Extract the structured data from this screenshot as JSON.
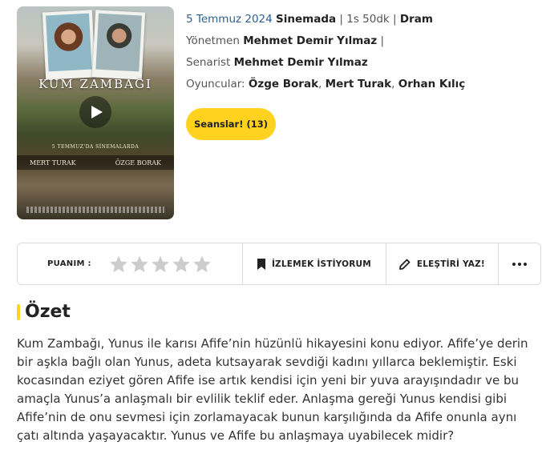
{
  "movie": {
    "poster": {
      "title": "KUM ZAMBAĞI",
      "release_text": "5 TEMMUZ'DA SİNEMALARDA",
      "actor_left": "MERT TURAK",
      "actor_right": "ÖZGE BORAK"
    },
    "release_date": "5 Temmuz 2024",
    "category": "Sinemada",
    "duration": "1s 50dk",
    "genre": "Dram",
    "separator": "|",
    "director_label": "Yönetmen",
    "director": "Mehmet Demir Yılmaz",
    "writer_label": "Senarist",
    "writer": "Mehmet Demir Yılmaz",
    "cast_label": "Oyuncular:",
    "cast": [
      "Özge Borak",
      "Mert Turak",
      "Orhan Kılıç"
    ],
    "sessions_button": "Seanslar! (13)"
  },
  "actions": {
    "rating_label": "PUANIM :",
    "star_count": 5,
    "watchlist_label": "İZLEMEK İSTİYORUM",
    "review_label": "ELEŞTİRİ YAZ!",
    "icons": {
      "star": "star-icon",
      "watchlist": "bookmark-icon",
      "review": "pencil-icon",
      "more": "more-dots-icon",
      "play": "play-icon"
    },
    "colors": {
      "accent": "#ffd21f",
      "star_empty": "#cccccc"
    }
  },
  "summary": {
    "title": "Özet",
    "text": "Kum Zambağı, Yunus ile karısı Afife’nin hüzünlü hikayesini konu ediyor. Afife’ye derin bir aşkla bağlı olan Yunus, adeta kutsayarak sevdiği kadını yıllarca beklemiştir. Eski kocasından eziyet gören Afife ise artık kendisi için yeni bir yuva arayışındadır ve bu amaçla Yunus’a anlaşmalı bir evlilik teklif eder. Anlaşma gereği Yunus kendisi gibi Afife’nin de onu sevmesi için zorlamayacak bunun karşılığında da Afife onunla aynı çatı altında yaşayacaktır. Yunus ve Afife bu anlaşmaya uyabilecek midir?"
  }
}
